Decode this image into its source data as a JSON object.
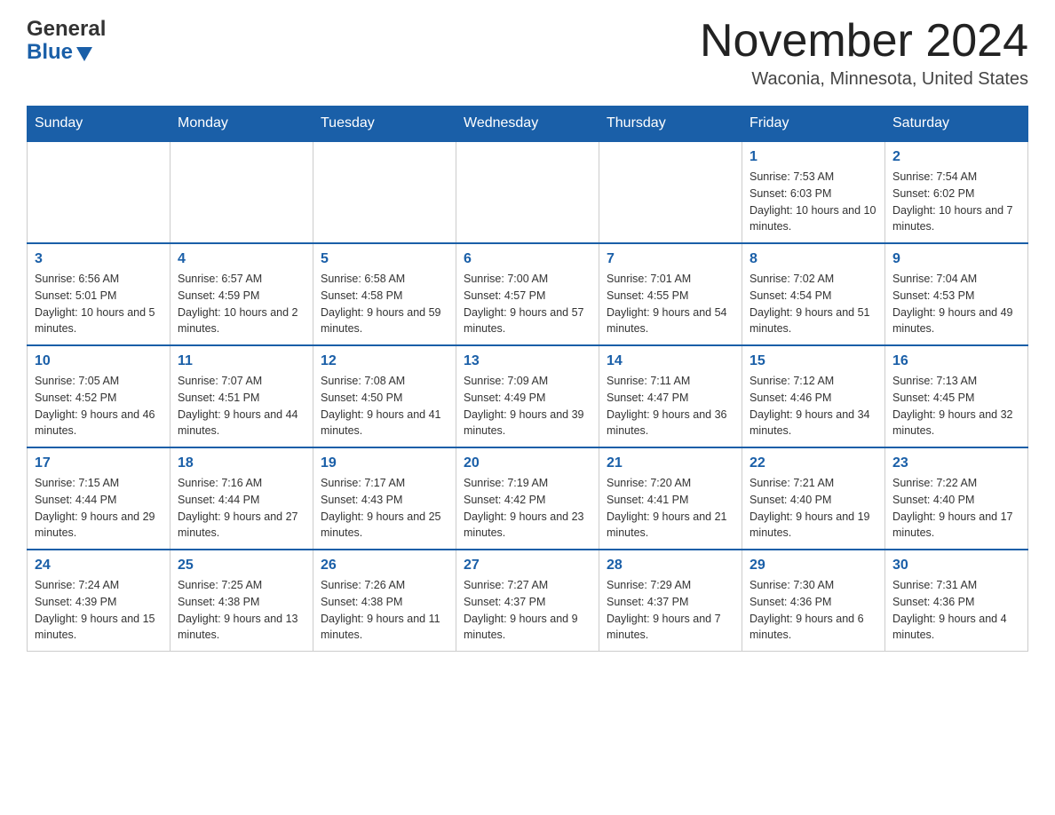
{
  "header": {
    "logo_general": "General",
    "logo_blue": "Blue",
    "month_title": "November 2024",
    "location": "Waconia, Minnesota, United States"
  },
  "calendar": {
    "days_of_week": [
      "Sunday",
      "Monday",
      "Tuesday",
      "Wednesday",
      "Thursday",
      "Friday",
      "Saturday"
    ],
    "weeks": [
      [
        {
          "day": "",
          "info": ""
        },
        {
          "day": "",
          "info": ""
        },
        {
          "day": "",
          "info": ""
        },
        {
          "day": "",
          "info": ""
        },
        {
          "day": "",
          "info": ""
        },
        {
          "day": "1",
          "info": "Sunrise: 7:53 AM\nSunset: 6:03 PM\nDaylight: 10 hours and 10 minutes."
        },
        {
          "day": "2",
          "info": "Sunrise: 7:54 AM\nSunset: 6:02 PM\nDaylight: 10 hours and 7 minutes."
        }
      ],
      [
        {
          "day": "3",
          "info": "Sunrise: 6:56 AM\nSunset: 5:01 PM\nDaylight: 10 hours and 5 minutes."
        },
        {
          "day": "4",
          "info": "Sunrise: 6:57 AM\nSunset: 4:59 PM\nDaylight: 10 hours and 2 minutes."
        },
        {
          "day": "5",
          "info": "Sunrise: 6:58 AM\nSunset: 4:58 PM\nDaylight: 9 hours and 59 minutes."
        },
        {
          "day": "6",
          "info": "Sunrise: 7:00 AM\nSunset: 4:57 PM\nDaylight: 9 hours and 57 minutes."
        },
        {
          "day": "7",
          "info": "Sunrise: 7:01 AM\nSunset: 4:55 PM\nDaylight: 9 hours and 54 minutes."
        },
        {
          "day": "8",
          "info": "Sunrise: 7:02 AM\nSunset: 4:54 PM\nDaylight: 9 hours and 51 minutes."
        },
        {
          "day": "9",
          "info": "Sunrise: 7:04 AM\nSunset: 4:53 PM\nDaylight: 9 hours and 49 minutes."
        }
      ],
      [
        {
          "day": "10",
          "info": "Sunrise: 7:05 AM\nSunset: 4:52 PM\nDaylight: 9 hours and 46 minutes."
        },
        {
          "day": "11",
          "info": "Sunrise: 7:07 AM\nSunset: 4:51 PM\nDaylight: 9 hours and 44 minutes."
        },
        {
          "day": "12",
          "info": "Sunrise: 7:08 AM\nSunset: 4:50 PM\nDaylight: 9 hours and 41 minutes."
        },
        {
          "day": "13",
          "info": "Sunrise: 7:09 AM\nSunset: 4:49 PM\nDaylight: 9 hours and 39 minutes."
        },
        {
          "day": "14",
          "info": "Sunrise: 7:11 AM\nSunset: 4:47 PM\nDaylight: 9 hours and 36 minutes."
        },
        {
          "day": "15",
          "info": "Sunrise: 7:12 AM\nSunset: 4:46 PM\nDaylight: 9 hours and 34 minutes."
        },
        {
          "day": "16",
          "info": "Sunrise: 7:13 AM\nSunset: 4:45 PM\nDaylight: 9 hours and 32 minutes."
        }
      ],
      [
        {
          "day": "17",
          "info": "Sunrise: 7:15 AM\nSunset: 4:44 PM\nDaylight: 9 hours and 29 minutes."
        },
        {
          "day": "18",
          "info": "Sunrise: 7:16 AM\nSunset: 4:44 PM\nDaylight: 9 hours and 27 minutes."
        },
        {
          "day": "19",
          "info": "Sunrise: 7:17 AM\nSunset: 4:43 PM\nDaylight: 9 hours and 25 minutes."
        },
        {
          "day": "20",
          "info": "Sunrise: 7:19 AM\nSunset: 4:42 PM\nDaylight: 9 hours and 23 minutes."
        },
        {
          "day": "21",
          "info": "Sunrise: 7:20 AM\nSunset: 4:41 PM\nDaylight: 9 hours and 21 minutes."
        },
        {
          "day": "22",
          "info": "Sunrise: 7:21 AM\nSunset: 4:40 PM\nDaylight: 9 hours and 19 minutes."
        },
        {
          "day": "23",
          "info": "Sunrise: 7:22 AM\nSunset: 4:40 PM\nDaylight: 9 hours and 17 minutes."
        }
      ],
      [
        {
          "day": "24",
          "info": "Sunrise: 7:24 AM\nSunset: 4:39 PM\nDaylight: 9 hours and 15 minutes."
        },
        {
          "day": "25",
          "info": "Sunrise: 7:25 AM\nSunset: 4:38 PM\nDaylight: 9 hours and 13 minutes."
        },
        {
          "day": "26",
          "info": "Sunrise: 7:26 AM\nSunset: 4:38 PM\nDaylight: 9 hours and 11 minutes."
        },
        {
          "day": "27",
          "info": "Sunrise: 7:27 AM\nSunset: 4:37 PM\nDaylight: 9 hours and 9 minutes."
        },
        {
          "day": "28",
          "info": "Sunrise: 7:29 AM\nSunset: 4:37 PM\nDaylight: 9 hours and 7 minutes."
        },
        {
          "day": "29",
          "info": "Sunrise: 7:30 AM\nSunset: 4:36 PM\nDaylight: 9 hours and 6 minutes."
        },
        {
          "day": "30",
          "info": "Sunrise: 7:31 AM\nSunset: 4:36 PM\nDaylight: 9 hours and 4 minutes."
        }
      ]
    ]
  }
}
